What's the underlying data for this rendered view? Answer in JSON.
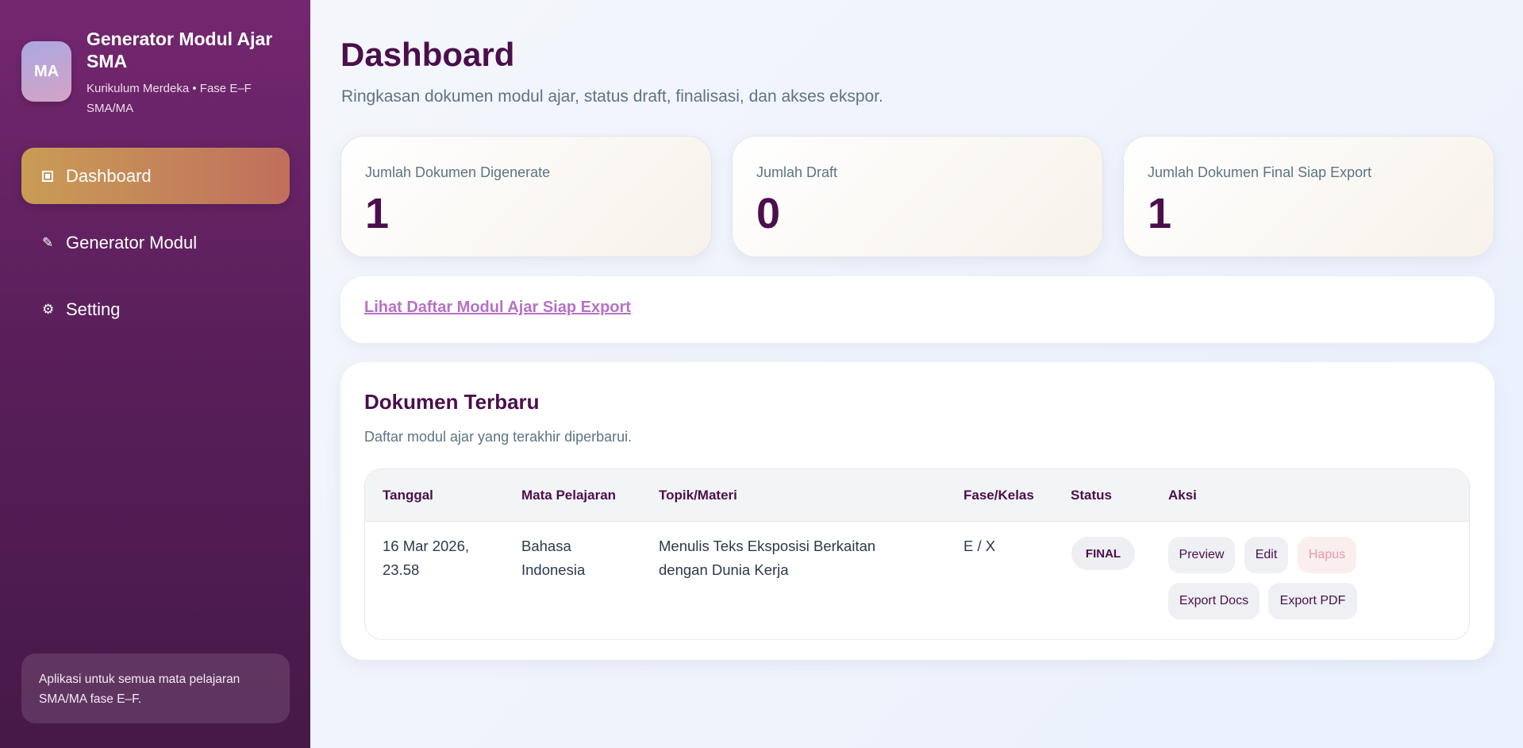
{
  "sidebar": {
    "logo_text": "MA",
    "title": "Generator Modul Ajar SMA",
    "subtitle": "Kurikulum Merdeka • Fase E–F SMA/MA",
    "items": [
      {
        "label": "Dashboard",
        "icon": "dashboard-icon",
        "active": true
      },
      {
        "label": "Generator Modul",
        "icon": "pencil-icon",
        "active": false
      },
      {
        "label": "Setting",
        "icon": "gear-icon",
        "active": false
      }
    ],
    "note": "Aplikasi untuk semua mata pelajaran SMA/MA fase E–F."
  },
  "header": {
    "title": "Dashboard",
    "subtitle": "Ringkasan dokumen modul ajar, status draft, finalisasi, dan akses ekspor."
  },
  "stats": [
    {
      "label": "Jumlah Dokumen Digenerate",
      "value": "1"
    },
    {
      "label": "Jumlah Draft",
      "value": "0"
    },
    {
      "label": "Jumlah Dokumen Final Siap Export",
      "value": "1"
    }
  ],
  "link": {
    "label": "Lihat Daftar Modul Ajar Siap Export"
  },
  "recent": {
    "title": "Dokumen Terbaru",
    "subtitle": "Daftar modul ajar yang terakhir diperbarui.",
    "columns": [
      "Tanggal",
      "Mata Pelajaran",
      "Topik/Materi",
      "Fase/Kelas",
      "Status",
      "Aksi"
    ],
    "rows": [
      {
        "date_line1": "16 Mar 2026,",
        "date_line2": "23.58",
        "subject_line1": "Bahasa",
        "subject_line2": "Indonesia",
        "topic_line1": "Menulis Teks Eksposisi Berkaitan",
        "topic_line2": "dengan Dunia Kerja",
        "phase": "E / X",
        "status": "FINAL",
        "actions": {
          "preview": "Preview",
          "edit": "Edit",
          "delete": "Hapus",
          "export_docs": "Export Docs",
          "export_pdf": "Export PDF"
        }
      }
    ]
  },
  "colors": {
    "sidebar_top": "#74276f",
    "sidebar_bottom": "#461948",
    "active_nav_start": "#c99c55",
    "active_nav_end": "#c06f5d",
    "heading": "#4a0f4c",
    "link": "#b572c4",
    "danger_text": "#e59aaa"
  }
}
